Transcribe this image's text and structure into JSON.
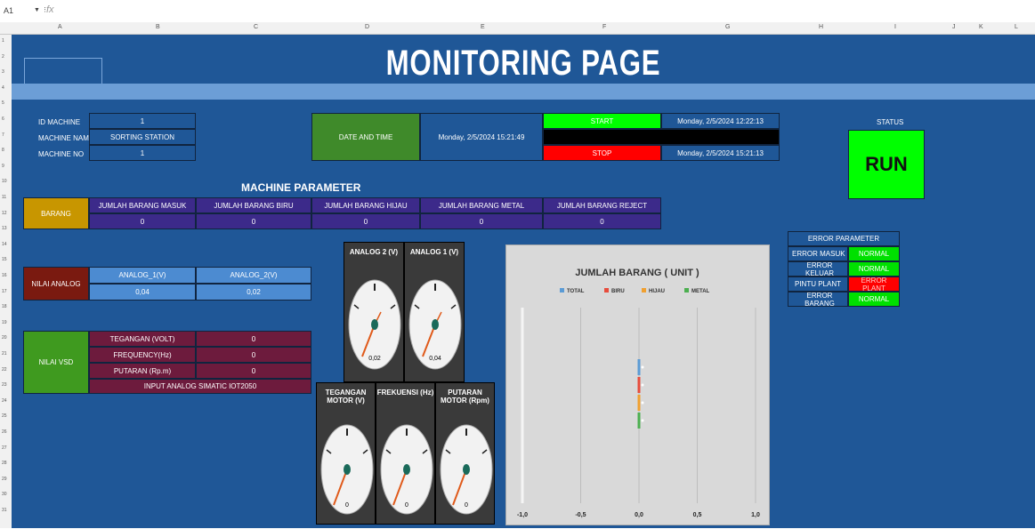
{
  "formula_bar": {
    "name_box": "A1",
    "fx": "fx"
  },
  "columns": [
    "A",
    "B",
    "C",
    "D",
    "E",
    "F",
    "G",
    "H",
    "I",
    "J",
    "K",
    "L"
  ],
  "rows": [
    "1",
    "2",
    "3",
    "4",
    "5",
    "6",
    "7",
    "8",
    "9",
    "10",
    "11",
    "12",
    "13",
    "14",
    "15",
    "16",
    "17",
    "18",
    "19",
    "20",
    "21",
    "22",
    "23",
    "24",
    "25",
    "26",
    "27",
    "28",
    "29",
    "30",
    "31"
  ],
  "title": "MONITORING PAGE",
  "machine": {
    "id_label": "ID MACHINE",
    "id_value": "1",
    "name_label": "MACHINE NAME",
    "name_value": "SORTING STATION",
    "no_label": "MACHINE NO",
    "no_value": "1"
  },
  "datetime": {
    "label": "DATE AND TIME",
    "value": "Monday, 2/5/2024 15:21:49",
    "start_label": "START",
    "start_time": "Monday, 2/5/2024 12:22:13",
    "stop_label": "STOP",
    "stop_time": "Monday, 2/5/2024 15:21:13"
  },
  "status": {
    "label": "STATUS",
    "value": "RUN",
    "color": "#00ff00"
  },
  "machine_parameter": {
    "title": "MACHINE PARAMETER",
    "row_label": "BARANG",
    "headers": [
      "JUMLAH BARANG MASUK",
      "JUMLAH BARANG BIRU",
      "JUMLAH BARANG HIJAU",
      "JUMLAH BARANG METAL",
      "JUMLAH BARANG REJECT"
    ],
    "values": [
      "0",
      "0",
      "0",
      "0",
      "0"
    ]
  },
  "analog": {
    "label": "NILAI ANALOG",
    "headers": [
      "ANALOG_1(V)",
      "ANALOG_2(V)"
    ],
    "values": [
      "0,04",
      "0,02"
    ]
  },
  "vsd": {
    "label": "NILAI VSD",
    "rows": [
      {
        "label": "TEGANGAN (VOLT)",
        "value": "0"
      },
      {
        "label": "FREQUENCY(Hz)",
        "value": "0"
      },
      {
        "label": "PUTARAN (Rp.m)",
        "value": "0"
      }
    ],
    "footer": "INPUT ANALOG SIMATIC IOT2050"
  },
  "gauges_top": [
    {
      "title": "ANALOG 2 (V)",
      "value": "0,02"
    },
    {
      "title": "ANALOG 1 (V)",
      "value": "0,04"
    }
  ],
  "gauges_bottom": [
    {
      "title": "TEGANGAN MOTOR (V)",
      "value": "0"
    },
    {
      "title": "FREKUENSI (Hz)",
      "value": "0"
    },
    {
      "title": "PUTARAN MOTOR (Rpm)",
      "value": "0"
    }
  ],
  "error_parameter": {
    "title": "ERROR PARAMETER",
    "rows": [
      {
        "label": "ERROR MASUK",
        "value": "NORMAL",
        "color": "#00e000"
      },
      {
        "label": "ERROR KELUAR",
        "value": "NORMAL",
        "color": "#00e000"
      },
      {
        "label": "PINTU PLANT",
        "value": "ERROR PLANT",
        "color": "#ff0000"
      },
      {
        "label": "ERROR BARANG",
        "value": "NORMAL",
        "color": "#00e000"
      }
    ]
  },
  "colors": {
    "sheet_bg": "#1f5797",
    "band": "#6c9ed6",
    "barang": "#c89600",
    "analog_label": "#7a1a10",
    "vsd_label": "#3f9a1f",
    "purple": "#3c2a8a",
    "maroon": "#6d1b3d",
    "datetime_label": "#3f8a2a",
    "blue_cell": "#4c8bd1",
    "green": "#00ff00",
    "red": "#ff0000"
  },
  "chart_data": {
    "type": "bar",
    "title": "JUMLAH BARANG ( UNIT )",
    "series": [
      {
        "name": "TOTAL",
        "values": [
          0
        ],
        "color": "#5b9bd5"
      },
      {
        "name": "BIRU",
        "values": [
          0
        ],
        "color": "#e74c3c"
      },
      {
        "name": "HIJAU",
        "values": [
          0
        ],
        "color": "#f0a030"
      },
      {
        "name": "METAL",
        "values": [
          0
        ],
        "color": "#4caf50"
      }
    ],
    "xlim": [
      -1.0,
      1.0
    ],
    "xticks": [
      "-1,0",
      "-0,5",
      "0,0",
      "0,5",
      "1,0"
    ],
    "legend": "top",
    "orientation": "horizontal",
    "grid": true
  }
}
